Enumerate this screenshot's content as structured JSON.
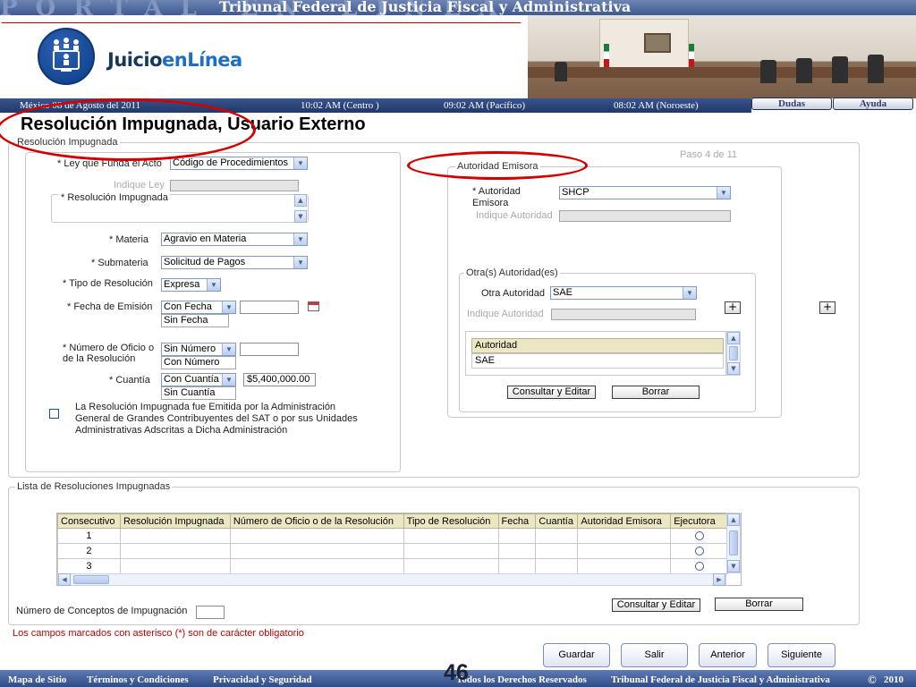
{
  "header": {
    "banner_title": "Tribunal Federal de Justicia Fiscal y Administrativa",
    "banner_ghost": "PORTAL      EN LÍNEA",
    "logo_part1": "Juicio",
    "logo_part2": "enLínea",
    "date_left": "México 08 de Agosto del 2011",
    "time_centro": "10:02  AM (Centro )",
    "time_pacifico": "09:02 AM  (Pacífico)",
    "time_noroeste": "08:02 AM (Noroeste)",
    "dudas_label": "Dudas",
    "ayuda_label": "Ayuda"
  },
  "page_title": "Resolución Impugnada, Usuario Externo",
  "left_panel": {
    "legend": "Resolución Impugnada",
    "ley_label": "* Ley que Funda el Acto",
    "ley_value": "Código de Procedimientos",
    "indique_ley": "Indique Ley",
    "resolucion_label": "* Resolución Impugnada",
    "materia_label": "* Materia",
    "materia_value": "Agravio en Materia",
    "submateria_label": "* Submateria",
    "submateria_value": "Solicitud de Pagos",
    "tipo_label": "* Tipo de Resolución",
    "tipo_value": "Expresa",
    "fecha_label": "* Fecha de Emisión",
    "fecha_value": "Con Fecha",
    "fecha_option": "Sin Fecha",
    "numero_label_1": "* Número de Oficio o",
    "numero_label_2": "de la Resolución",
    "numero_value": "Sin Número",
    "numero_option": "Con Número",
    "cuantia_label": "* Cuantía",
    "cuantia_value": "Con Cuantía",
    "cuantia_option": "Sin Cuantía",
    "cuantia_amount": "$5,400,000.00",
    "sat_text_1": "La Resolución Impugnada fue Emitida por la Administración",
    "sat_text_2": "General de Grandes Contribuyentes del SAT o por sus Unidades",
    "sat_text_3": "Administrativas Adscritas a Dicha Administración"
  },
  "right_panel": {
    "step": "Paso 4 de 11",
    "legend": "Autoridad Emisora",
    "autoridad_label_1": "* Autoridad",
    "autoridad_label_2": "Emisora",
    "autoridad_value": "SHCP",
    "indique_autoridad": "Indique Autoridad",
    "otras_legend": "Otra(s) Autoridad(es)",
    "otra_label": "Otra Autoridad",
    "otra_value": "SAE",
    "indique_autoridad_2": "Indique Autoridad",
    "list_header": "Autoridad",
    "list_items": [
      "SAE"
    ],
    "consultar_label": "Consultar y Editar",
    "borrar_label": "Borrar",
    "plus_label": "+"
  },
  "list_section": {
    "legend": "Lista de Resoluciones Impugnadas",
    "columns": [
      "Consecutivo",
      "Resolución Impugnada",
      "Número de Oficio o de la Resolución",
      "Tipo de Resolución",
      "Fecha",
      "Cuantía",
      "Autoridad Emisora",
      "Ejecutora"
    ],
    "rows": [
      "1",
      "2",
      "3"
    ],
    "conceptos_label": "Número de Conceptos de Impugnación",
    "consultar_label": "Consultar y Editar",
    "borrar_label": "Borrar",
    "required_note": "Los campos marcados con asterisco (*) son de carácter obligatorio"
  },
  "nav_buttons": {
    "guardar": "Guardar",
    "salir": "Salir",
    "anterior": "Anterior",
    "siguiente": "Siguiente"
  },
  "footer": {
    "mapa": "Mapa de Sitio",
    "terminos": "Términos y Condiciones",
    "privacidad": "Privacidad y Seguridad",
    "derechos": "Todos los Derechos Reservados",
    "tribunal": "Tribunal Federal de Justicia Fiscal y Administrativa",
    "copyright": "©",
    "year": "2010"
  },
  "slide_number": "46",
  "colors": {
    "accent_red": "#d40000",
    "header_blue": "#20386a",
    "logo_blue": "#17375e"
  }
}
